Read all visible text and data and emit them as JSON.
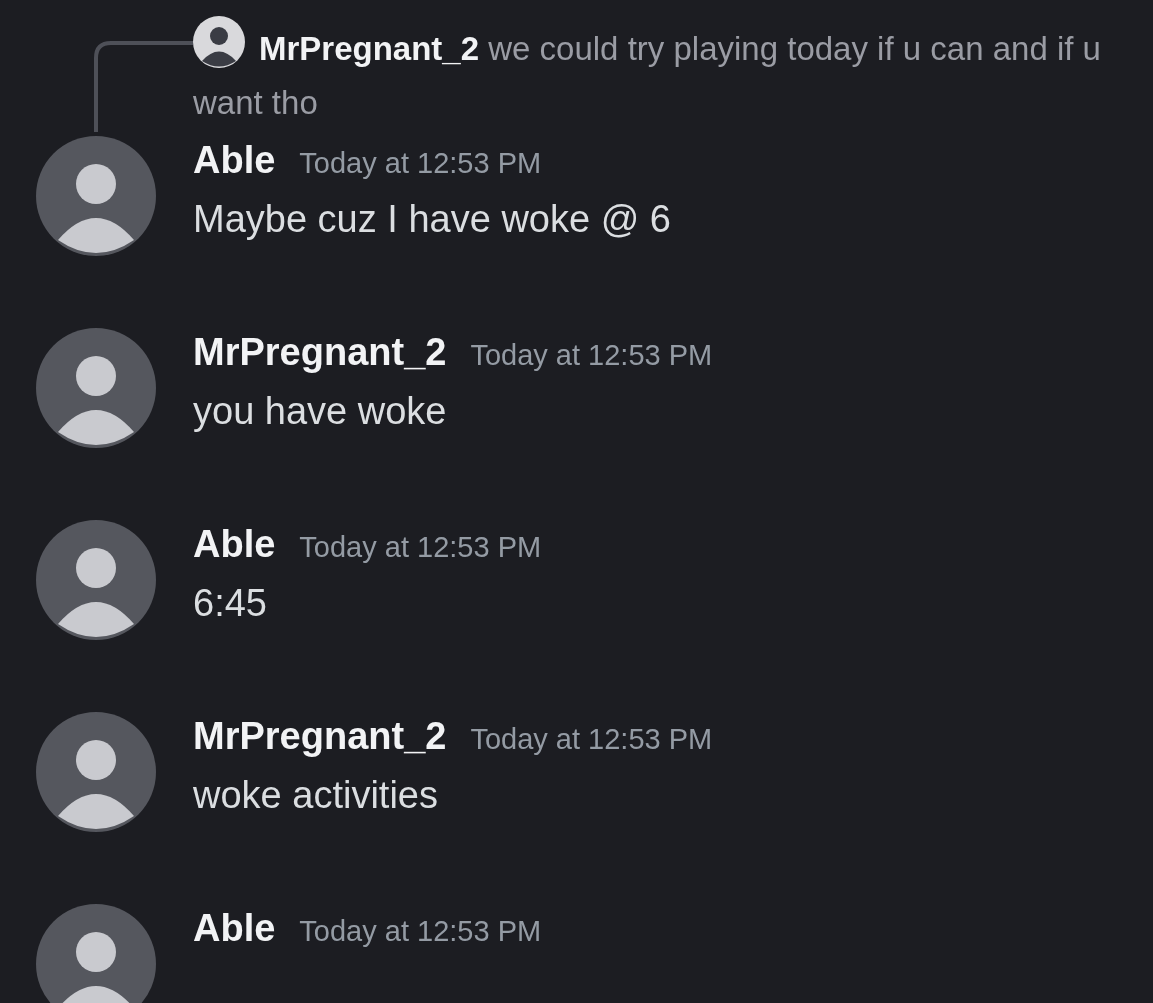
{
  "reply": {
    "author": "MrPregnant_2",
    "text": "we could try playing today if u can and if u want tho"
  },
  "messages": [
    {
      "author": "Able",
      "time": "Today at 12:53 PM",
      "text": "Maybe cuz I have woke @ 6"
    },
    {
      "author": "MrPregnant_2",
      "time": "Today at 12:53 PM",
      "text": "you have woke"
    },
    {
      "author": "Able",
      "time": "Today at 12:53 PM",
      "text": "6:45"
    },
    {
      "author": "MrPregnant_2",
      "time": "Today at 12:53 PM",
      "text": "woke activities"
    },
    {
      "author": "Able",
      "time": "Today at 12:53 PM"
    }
  ]
}
